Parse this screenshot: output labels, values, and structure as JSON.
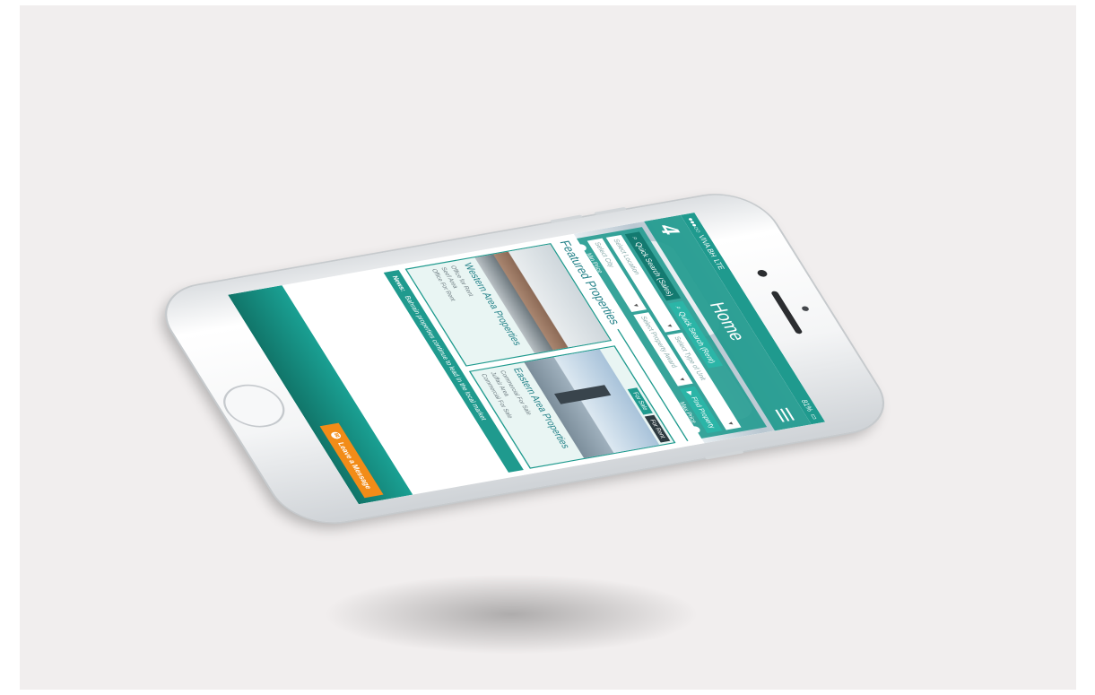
{
  "status_bar": {
    "carrier": "VIVA BH",
    "network": "LTE",
    "battery": "81%"
  },
  "header": {
    "logo": "4",
    "title": "Home"
  },
  "search": {
    "tab_quick": "Quick Search (Sales)",
    "tab_rent": "Quick Search (Rent)",
    "location_placeholder": "Select Location",
    "city_placeholder": "Select City",
    "type_placeholder": "Select Type of Unit",
    "property_placeholder": "Select Property Award",
    "filter_label": "Find Property",
    "price_min_label": "Min Price",
    "price_max_label": "Max Price",
    "search_button": "Search"
  },
  "featured": {
    "title": "Featured Properties",
    "cards": [
      {
        "name": "Western Area Properties",
        "type": "Office for Rent",
        "detail_1": "Seef Area",
        "detail_2": "Office For Rent"
      },
      {
        "name": "Eastern Area Properties",
        "type": "Commercial For Sale",
        "tab_sale": "For Sale",
        "tab_rent": "For Rent",
        "detail_1": "Juffair Area",
        "detail_2": "Commercial For Sale"
      }
    ]
  },
  "news": {
    "label": "News:",
    "text": "Bahrain properties continue to lead in the local market"
  },
  "footer": {
    "leave_message": "Leave a Message"
  },
  "colors": {
    "brand": "#1f9a8e",
    "accent": "#f28c18"
  }
}
